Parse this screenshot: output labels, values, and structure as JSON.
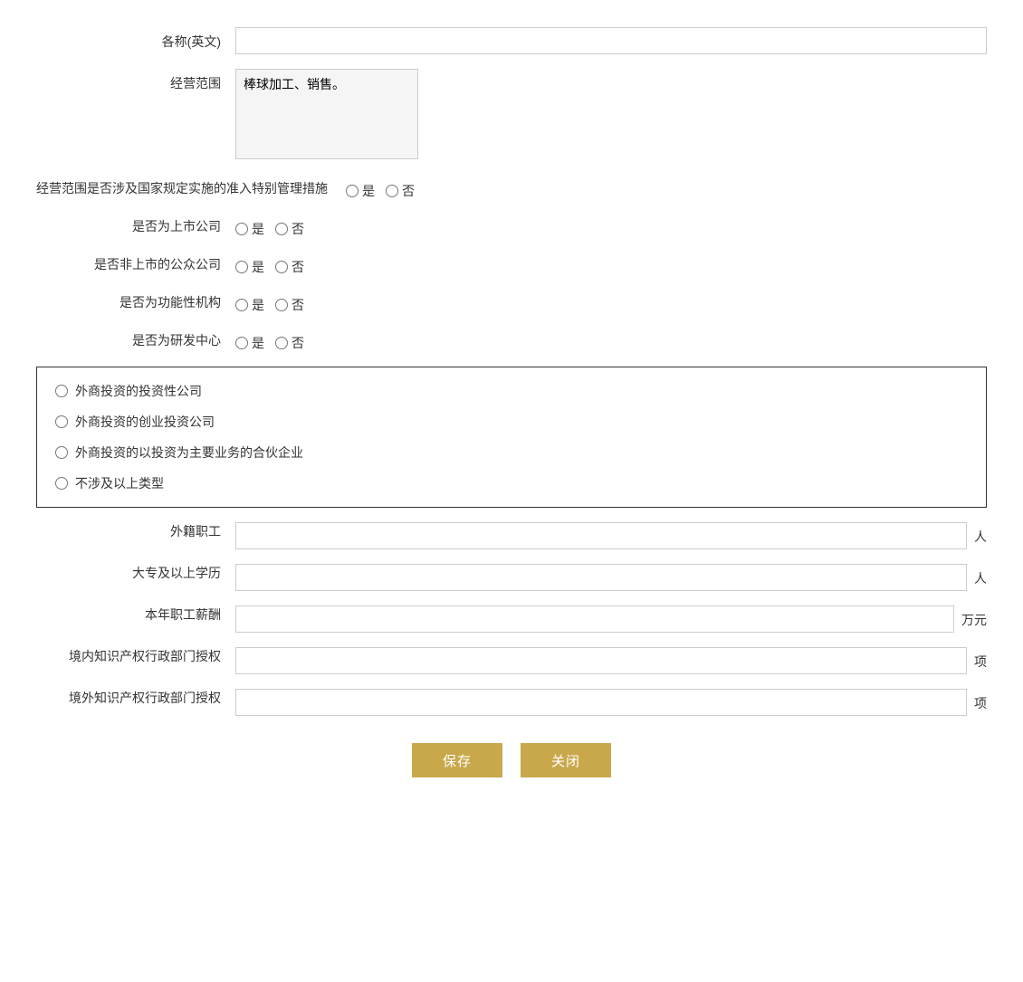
{
  "form": {
    "labels": {
      "name_en": "各称(英文)",
      "business_scope": "经营范围",
      "business_scope_special": "经营范围是否涉及国家规定实施的准入特别管理措施",
      "is_listed": "是否为上市公司",
      "is_public_unlisted": "是否非上市的公众公司",
      "is_functional": "是否为功能性机构",
      "is_research": "是否为研发中心",
      "foreign_employees": "外籍职工",
      "college_education": "大专及以上学历",
      "annual_salary": "本年职工薪酬",
      "domestic_ip": "境内知识产权行政部门授权",
      "foreign_ip": "境外知识产权行政部门授权"
    },
    "units": {
      "person": "人",
      "wan_yuan": "万元",
      "item": "项"
    },
    "radio_yes": "是",
    "radio_no": "否",
    "textarea_placeholder": "棒球加工、销售。",
    "checkbox_options": [
      "外商投资的投资性公司",
      "外商投资的创业投资公司",
      "外商投资的以投资为主要业务的合伙企业",
      "不涉及以上类型"
    ],
    "buttons": {
      "save": "保存",
      "close": "关闭"
    },
    "values": {
      "name_en": "",
      "foreign_employees": "",
      "college_education": "",
      "annual_salary": "",
      "domestic_ip": "",
      "foreign_ip": ""
    }
  }
}
